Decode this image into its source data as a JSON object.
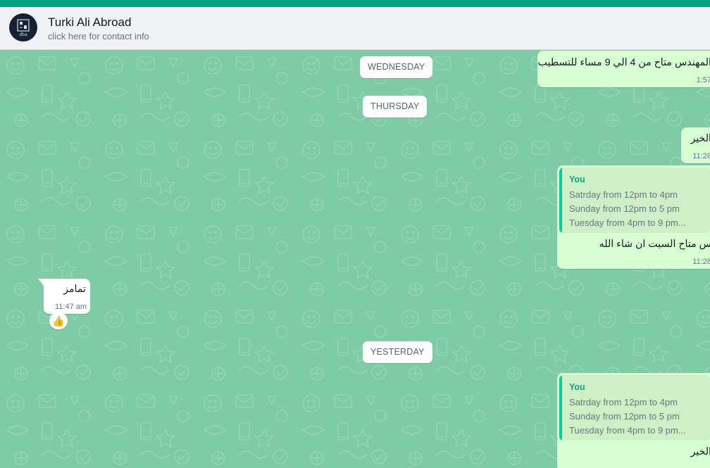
{
  "contact": {
    "name": "Turki Ali Abroad",
    "subtitle": "click here for contact info",
    "avatar_text": "dba"
  },
  "colors": {
    "top_bar": "#07a283",
    "header_bg": "#f0f2f5",
    "chat_bg": "#7ecba5",
    "outgoing_bubble": "#d9fdd3",
    "incoming_bubble": "#ffffff",
    "quote_accent": "#06cf9c"
  },
  "date_separators": [
    "WEDNESDAY",
    "THURSDAY",
    "YESTERDAY"
  ],
  "messages": [
    {
      "direction": "outgoing",
      "text": "المهندس متاح من 4 الي 9 مساء للتسطيب",
      "time": "1:57"
    },
    {
      "direction": "outgoing",
      "text": "الخير",
      "time": "11:28"
    },
    {
      "direction": "outgoing",
      "quote": {
        "author": "You",
        "lines": [
          "Satrday from 12pm to 4pm",
          "Sunday from 12pm to 5 pm",
          "Tuesday from 4pm to 9 pm..."
        ]
      },
      "text": "س متاح السبت ان شاء الله",
      "time": "11:28"
    },
    {
      "direction": "incoming",
      "text": "تمامز",
      "time": "11:47 am",
      "reaction": "👍",
      "reaction_icon": "thumbs-up"
    },
    {
      "direction": "outgoing",
      "quote": {
        "author": "You",
        "lines": [
          "Satrday from 12pm to 4pm",
          "Sunday from 12pm to 5 pm",
          "Tuesday from 4pm to 9 pm..."
        ]
      },
      "text": "الخير",
      "time": ""
    }
  ]
}
